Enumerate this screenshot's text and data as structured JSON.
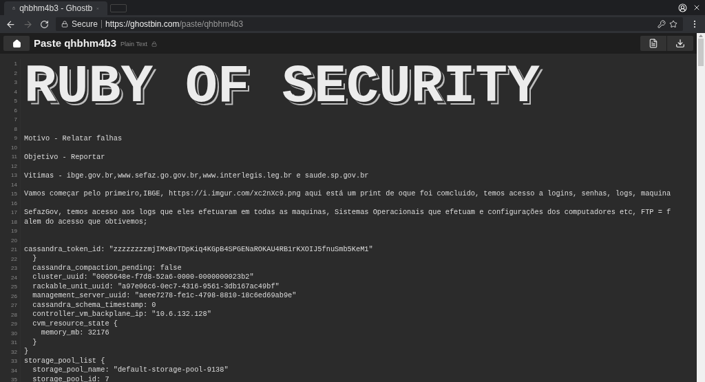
{
  "browser": {
    "tab": {
      "title": "qhbhm4b3 - Ghostb",
      "selected": true
    },
    "address": {
      "security": "Secure",
      "host": "https://ghostbin.com",
      "path": "/paste/qhbhm4b3"
    }
  },
  "header": {
    "title": "Paste qhbhm4b3",
    "language": "Plain Text"
  },
  "code": {
    "banner": "RUBY OF SECURITY",
    "banner_line_numbers": [
      "1",
      "2",
      "3",
      "4",
      "5",
      "6"
    ],
    "lines": [
      {
        "number": "7"
      },
      {
        "number": "8"
      },
      {
        "number": "9",
        "text": "Motivo - Relatar falhas"
      },
      {
        "number": "10"
      },
      {
        "number": "11",
        "text": "Objetivo - Reportar"
      },
      {
        "number": "12"
      },
      {
        "number": "13",
        "text": "Vitimas - ibge.gov.br,www.sefaz.go.gov.br,www.interlegis.leg.br e saude.sp.gov.br"
      },
      {
        "number": "14"
      },
      {
        "number": "15",
        "text": "Vamos começar pelo primeiro,IBGE, https://i.imgur.com/xc2nXc9.png aqui está um print de oque foi comcluido, temos acesso a logins, senhas, logs, maquina"
      },
      {
        "number": "16"
      },
      {
        "number": "17",
        "text": "SefazGov, temos acesso aos logs que eles efetuaram em todas as maquinas, Sistemas Operacionais que efetuam e configurações dos computadores etc, FTP = f"
      },
      {
        "number": "18",
        "text": "alem do acesso que obtivemos;"
      },
      {
        "number": "19"
      },
      {
        "number": "20"
      },
      {
        "number": "21",
        "text": "cassandra_token_id: \"zzzzzzzzmjIMxBvTDpKiq4KGpB4SPGENaROKAU4RB1rKXOIJ5fnuSmb5KeM1\""
      },
      {
        "number": "22",
        "text": "  }"
      },
      {
        "number": "23",
        "text": "  cassandra_compaction_pending: false"
      },
      {
        "number": "24",
        "text": "  cluster_uuid: \"0005648e-f7d8-52a6-0000-0000000023b2\""
      },
      {
        "number": "25",
        "text": "  rackable_unit_uuid: \"a97e06c6-0ec7-4316-9561-3db167ac49bf\""
      },
      {
        "number": "26",
        "text": "  management_server_uuid: \"aeee7278-fe1c-4798-8810-18c6ed69ab9e\""
      },
      {
        "number": "27",
        "text": "  cassandra_schema_timestamp: 0"
      },
      {
        "number": "28",
        "text": "  controller_vm_backplane_ip: \"10.6.132.128\""
      },
      {
        "number": "29",
        "text": "  cvm_resource_state {"
      },
      {
        "number": "30",
        "text": "    memory_mb: 32176"
      },
      {
        "number": "31",
        "text": "  }"
      },
      {
        "number": "32",
        "text": "}"
      },
      {
        "number": "33",
        "text": "storage_pool_list {"
      },
      {
        "number": "34",
        "text": "  storage_pool_name: \"default-storage-pool-9138\""
      },
      {
        "number": "35",
        "text": "  storage_pool_id: 7"
      }
    ]
  }
}
